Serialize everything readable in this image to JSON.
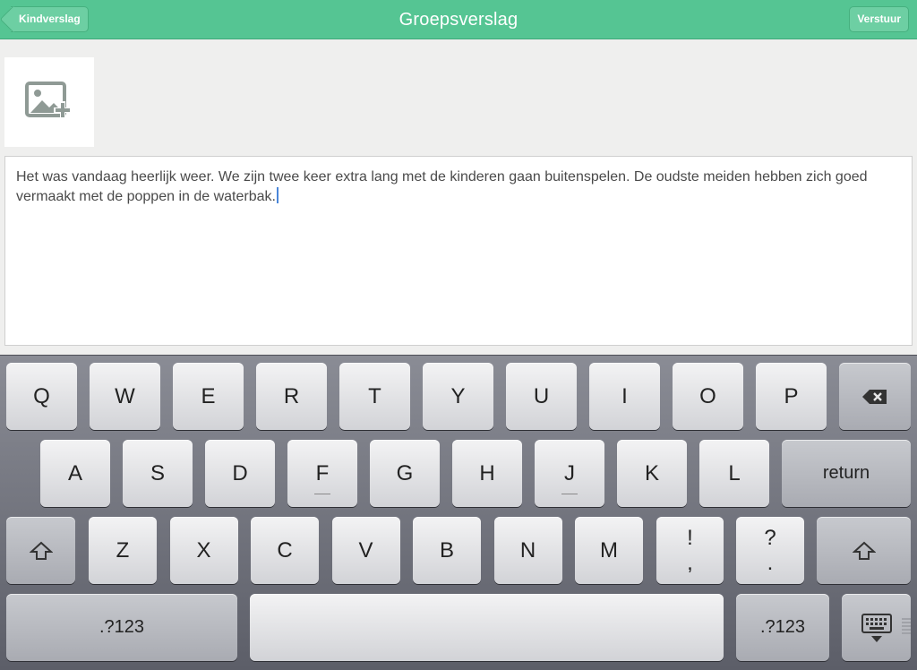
{
  "navbar": {
    "title": "Groepsverslag",
    "back_label": "Kindverslag",
    "send_label": "Verstuur",
    "color": "#55c593"
  },
  "photo": {
    "icon": "add-photo-icon"
  },
  "editor": {
    "text": "Het was vandaag heerlijk weer. We zijn twee keer extra lang met de kinderen gaan buitenspelen. De oudste meiden hebben zich goed vermaakt met de poppen in de waterbak."
  },
  "keyboard": {
    "row1": [
      "Q",
      "W",
      "E",
      "R",
      "T",
      "Y",
      "U",
      "I",
      "O",
      "P"
    ],
    "row2": [
      "A",
      "S",
      "D",
      "F",
      "G",
      "H",
      "J",
      "K",
      "L"
    ],
    "row3": [
      "Z",
      "X",
      "C",
      "V",
      "B",
      "N",
      "M"
    ],
    "exclaim_top": "!",
    "exclaim_bottom": ",",
    "question_top": "?",
    "question_bottom": ".",
    "return_label": "return",
    "numbers_label": ".?123",
    "backspace_icon": "backspace-icon",
    "shift_icon": "shift-icon",
    "dismiss_icon": "keyboard-dismiss-icon"
  }
}
